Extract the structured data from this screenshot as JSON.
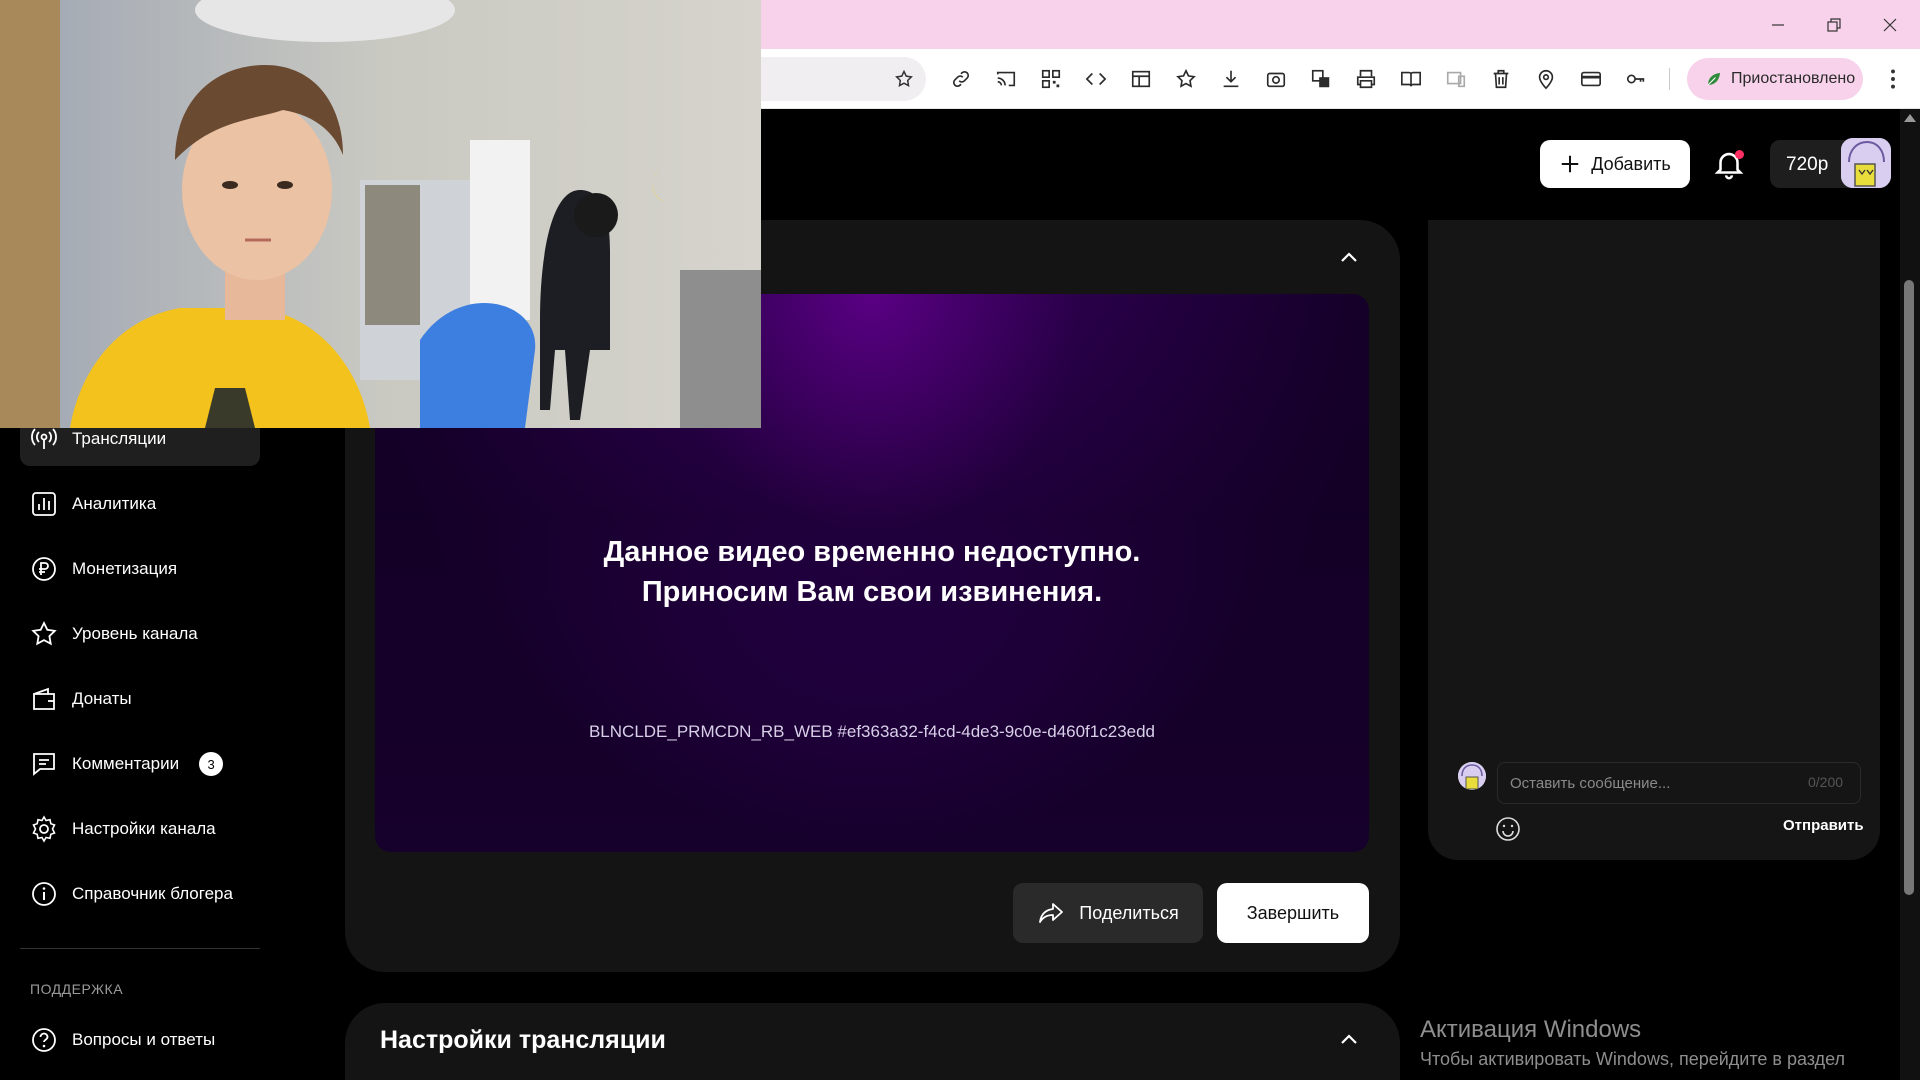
{
  "browser": {
    "paused_label": "Приостановлено"
  },
  "header": {
    "add_label": "Добавить",
    "quality_label": "720p"
  },
  "sidebar": {
    "items": [
      {
        "label": "Трансляции",
        "icon": "broadcast-icon",
        "active": true
      },
      {
        "label": "Аналитика",
        "icon": "analytics-icon"
      },
      {
        "label": "Монетизация",
        "icon": "ruble-icon"
      },
      {
        "label": "Уровень канала",
        "icon": "star-icon"
      },
      {
        "label": "Донаты",
        "icon": "wallet-icon"
      },
      {
        "label": "Комментарии",
        "icon": "comment-icon",
        "badge": "3"
      },
      {
        "label": "Настройки канала",
        "icon": "gear-icon"
      },
      {
        "label": "Справочник блогера",
        "icon": "info-icon"
      }
    ],
    "support_heading": "ПОДДЕРЖКА",
    "support_items": [
      {
        "label": "Вопросы и ответы",
        "icon": "question-icon"
      }
    ]
  },
  "player": {
    "message_line1": "Данное видео временно недоступно.",
    "message_line2": "Приносим Вам свои извинения.",
    "error_code": "BLNCLDE_PRMCDN_RB_WEB #ef363a32-f4cd-4de3-9c0e-d460f1c23edd"
  },
  "stream_actions": {
    "share_label": "Поделиться",
    "finish_label": "Завершить"
  },
  "settings": {
    "title": "Настройки трансляции"
  },
  "chat": {
    "input_placeholder": "Оставить сообщение...",
    "char_count": "0/200",
    "send_label": "Отправить"
  },
  "watermark": {
    "title": "Активация Windows",
    "text": "Чтобы активировать Windows, перейдите в раздел"
  },
  "colors": {
    "accent_pink": "#f7d2ea",
    "player_purple": "#2a0050",
    "notification_dot": "#ff2e63"
  }
}
